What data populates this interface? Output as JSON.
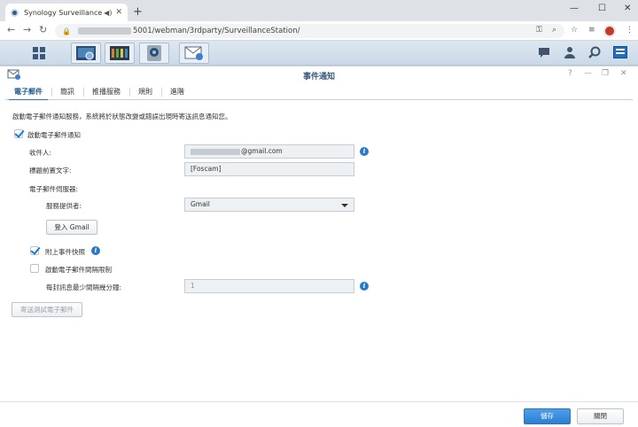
{
  "browser": {
    "tab_title": "Synology Surveillance Stati",
    "audio_icon": "◀)",
    "close_tab": "✕",
    "new_tab": "+",
    "minimize": "—",
    "maximize": "☐",
    "close": "✕",
    "url": "5001/webman/3rdparty/SurveillanceStation/",
    "back": "←",
    "forward": "→",
    "reload": "↻",
    "lock": "🔒",
    "key_icon": "⚿",
    "zoom_icon": "⌕",
    "star_icon": "☆",
    "queue_icon": "≡",
    "menu_icon": "⋮"
  },
  "window": {
    "title": "事件通知",
    "help": "?",
    "minimize": "—",
    "restore": "❐",
    "close": "✕"
  },
  "tabs": [
    "電子郵件",
    "簡訊",
    "推播服務",
    "規則",
    "進階"
  ],
  "email": {
    "description": "啟動電子郵件通知服務，系統將於狀態改變或錯誤出現時寄送訊息通知您。",
    "enable_label": "啟動電子郵件通知",
    "enable_checked": true,
    "recipient_label": "收件人:",
    "recipient_value": "@gmail.com",
    "subject_prefix_label": "標題前置文字:",
    "subject_prefix_value": "[Foscam]",
    "smtp_label": "電子郵件伺服器:",
    "provider_label": "服務提供者:",
    "provider_value": "Gmail",
    "login_button": "登入 Gmail",
    "attach_snapshot_label": "附上事件快照",
    "attach_snapshot_checked": true,
    "interval_label": "啟動電子郵件間隔限制",
    "interval_checked": false,
    "interval_minutes_label": "每封訊息最少間隔幾分鐘:",
    "interval_minutes_value": "1",
    "send_test_button": "寄送測試電子郵件",
    "info_glyph": "i"
  },
  "footer": {
    "save": "儲存",
    "close": "關閉"
  }
}
